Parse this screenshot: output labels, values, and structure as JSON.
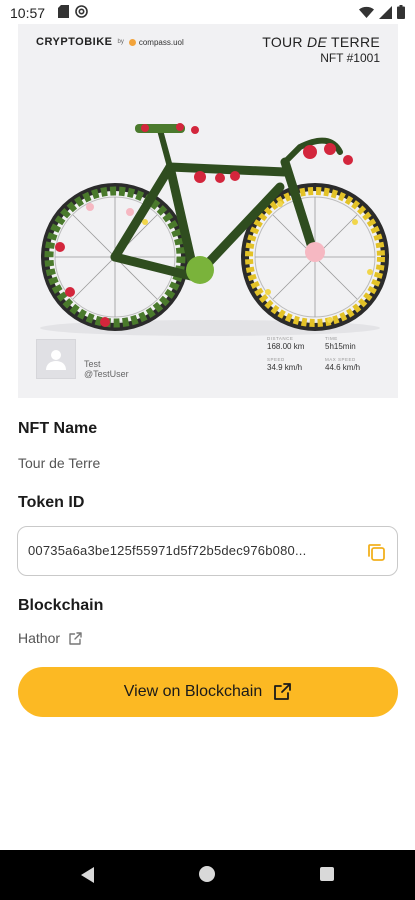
{
  "status_bar": {
    "time": "10:57",
    "icons_left": [
      "sd-card-icon",
      "at-sign-icon"
    ],
    "icons_right": [
      "wifi-icon",
      "signal-icon",
      "battery-icon"
    ]
  },
  "card": {
    "brand_name": "CRYPTOBIKE",
    "brand_by": "by",
    "brand_partner": "compass.uol",
    "title_main": "TOUR ",
    "title_italic": "DE",
    "title_end": " TERRE",
    "edition": "NFT #1001",
    "owner_name": "Test",
    "owner_handle": "@TestUser",
    "stats": [
      {
        "label": "DISTANCE",
        "value": "168.00 km"
      },
      {
        "label": "TIME",
        "value": "5h15min"
      },
      {
        "label": "SPEED",
        "value": "34.9 km/h"
      },
      {
        "label": "MAX SPEED",
        "value": "44.6 km/h"
      }
    ]
  },
  "details": {
    "nft_name_label": "NFT Name",
    "nft_name_value": "Tour de Terre",
    "token_id_label": "Token ID",
    "token_id_value": "00735a6a3be125f55971d5f72b5dec976b080...",
    "blockchain_label": "Blockchain",
    "blockchain_value": "Hathor"
  },
  "cta": {
    "label": "View on Blockchain"
  },
  "colors": {
    "accent": "#fcb923",
    "card_bg": "#f1f1f3",
    "copy_icon": "#f2b01e"
  }
}
